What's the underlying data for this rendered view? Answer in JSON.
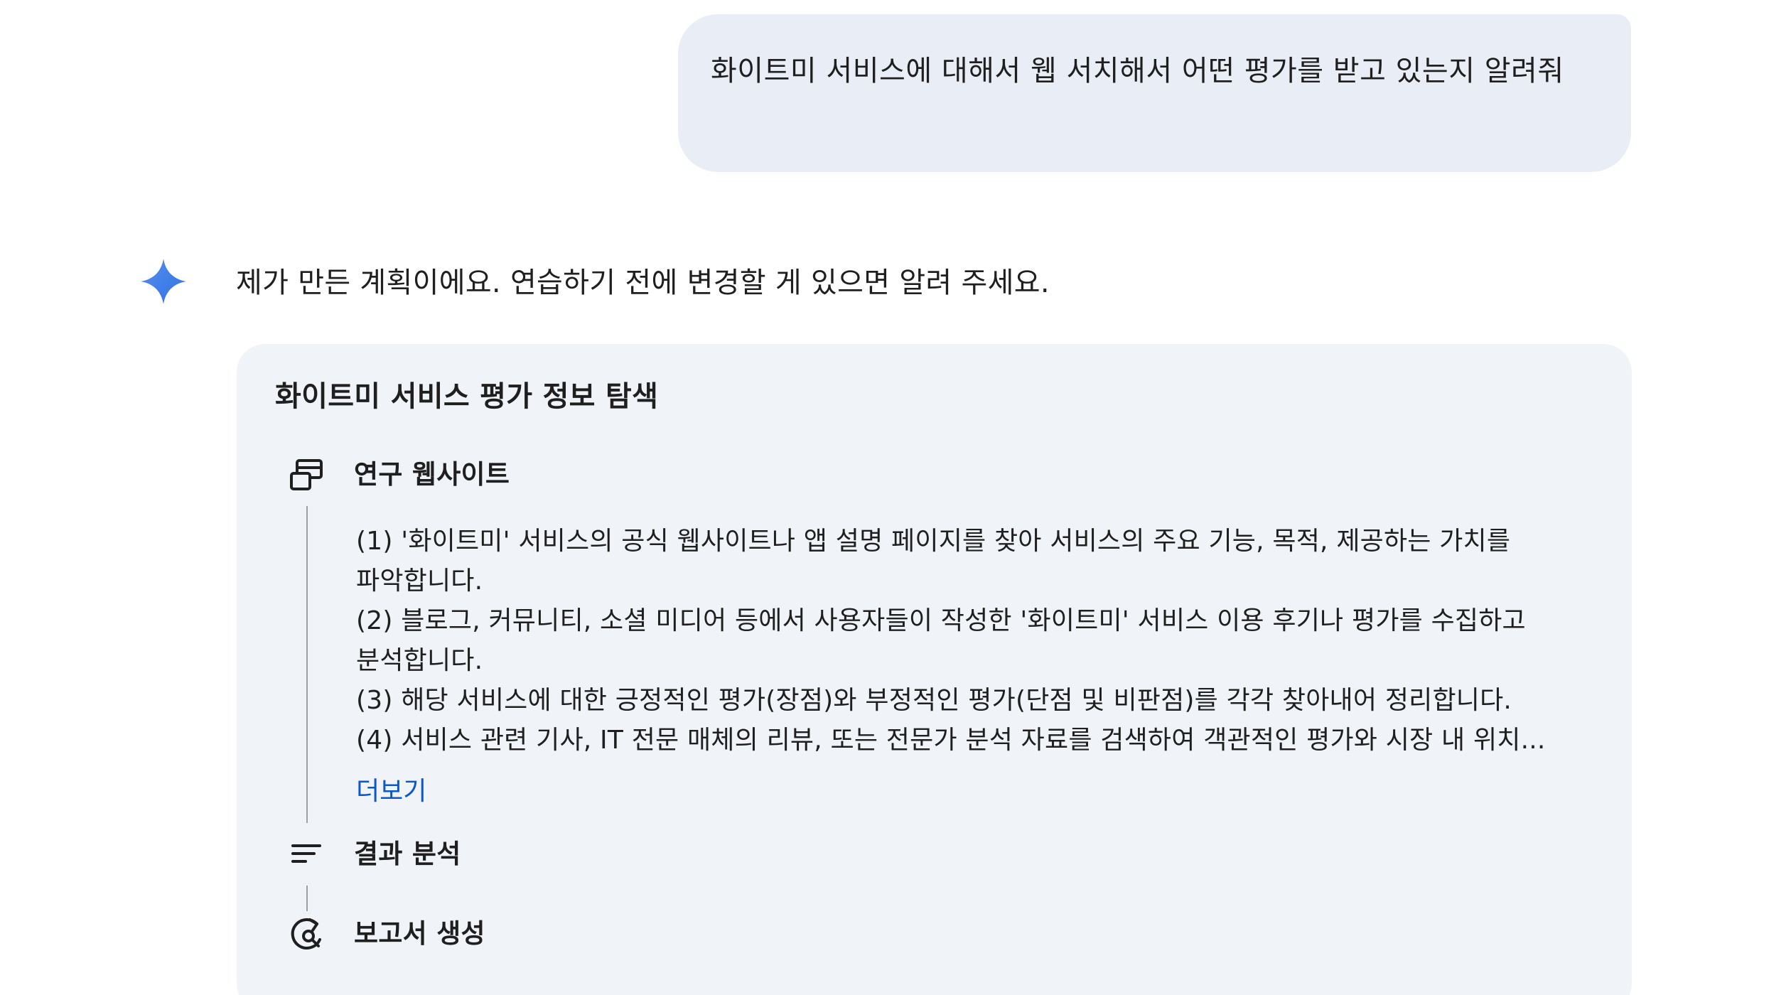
{
  "user_message": {
    "text": "화이트미 서비스에 대해서 웹 서치해서 어떤 평가를 받고 있는지 알려줘"
  },
  "assistant": {
    "icon": "gemini-spark-icon",
    "intro": "제가 만든 계획이에요. 연습하기 전에 변경할 게 있으면 알려 주세요.",
    "plan": {
      "title": "화이트미 서비스 평가 정보 탐색",
      "steps": [
        {
          "icon": "web-research-icon",
          "label": "연구 웹사이트",
          "items": [
            "(1) '화이트미' 서비스의 공식 웹사이트나 앱 설명 페이지를 찾아 서비스의 주요 기능, 목적, 제공하는 가치를 파악합니다.",
            "(2) 블로그, 커뮤니티, 소셜 미디어 등에서 사용자들이 작성한 '화이트미' 서비스 이용 후기나 평가를 수집하고 분석합니다.",
            "(3) 해당 서비스에 대한 긍정적인 평가(장점)와 부정적인 평가(단점 및 비판점)를 각각 찾아내어 정리합니다.",
            "(4) 서비스 관련 기사, IT 전문 매체의 리뷰, 또는 전문가 분석 자료를 검색하여 객관적인 평가와 시장 내 위치..."
          ],
          "more_label": "더보기"
        },
        {
          "icon": "analyze-results-icon",
          "label": "결과 분석"
        },
        {
          "icon": "create-report-icon",
          "label": "보고서 생성"
        }
      ]
    }
  },
  "colors": {
    "user_bubble": "#e9eef6",
    "plan_card": "#f0f4f9",
    "link": "#0b57d0",
    "spark_blue": "#4285f4"
  }
}
